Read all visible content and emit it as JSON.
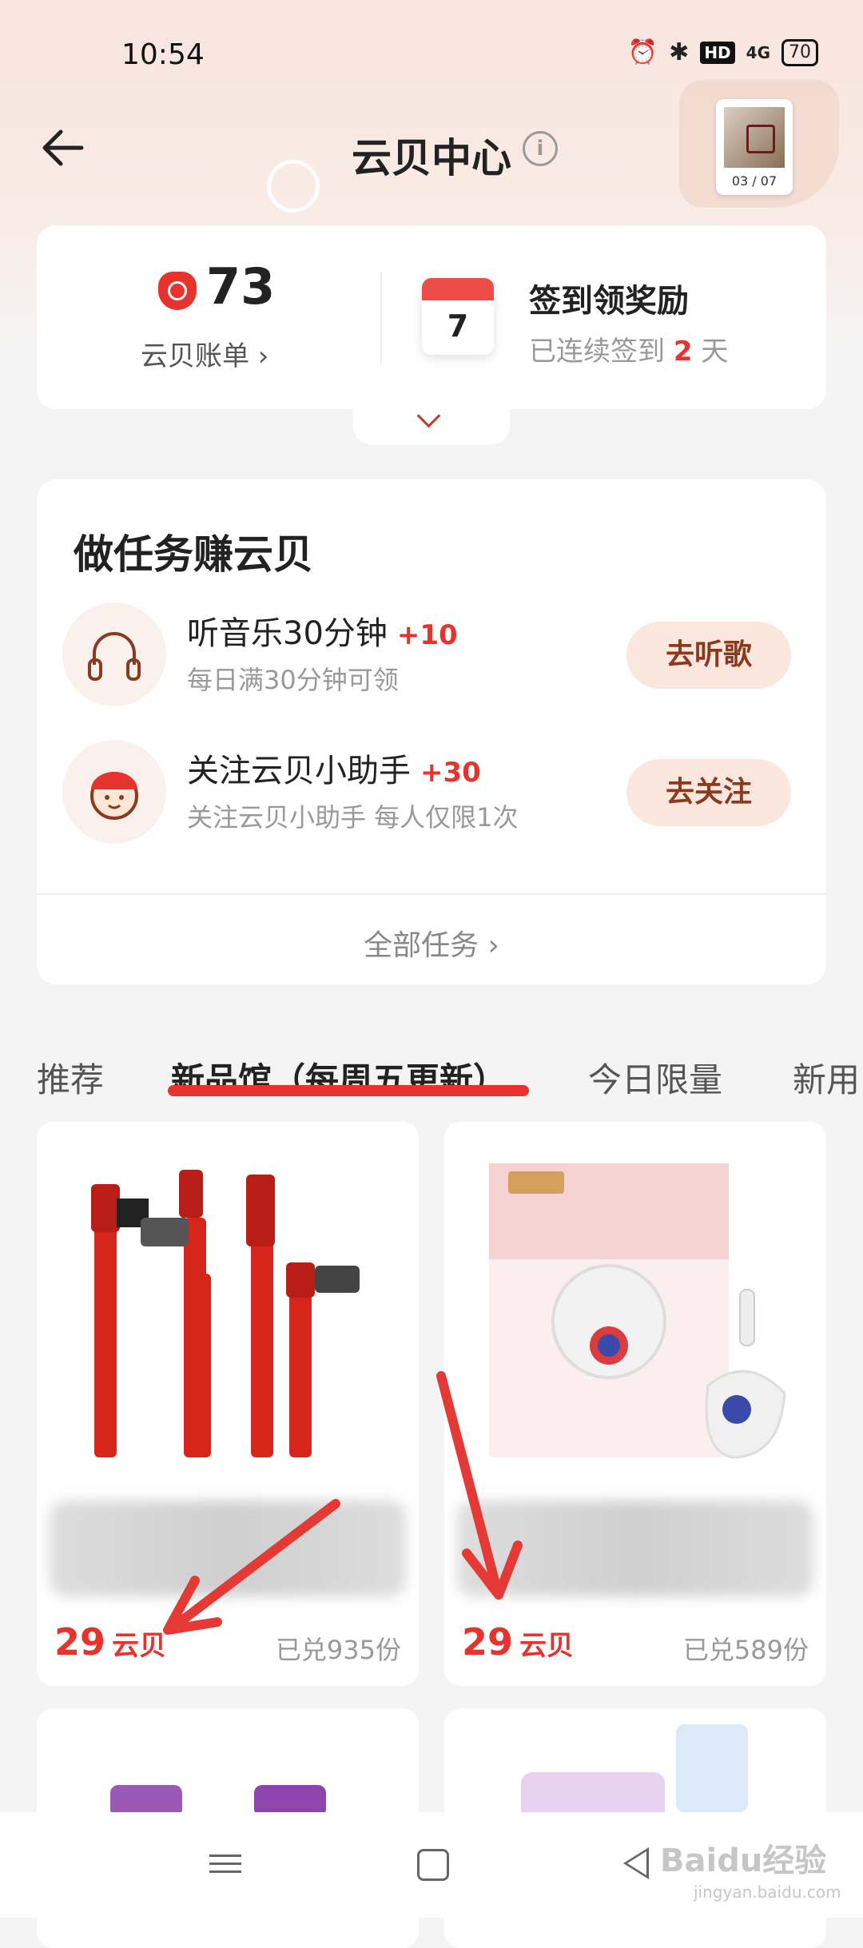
{
  "status_bar": {
    "time": "10:54",
    "hd_badge": "HD",
    "signal_label": "4G",
    "battery": "70"
  },
  "header": {
    "title": "云贝中心",
    "info_glyph": "i",
    "album_count": "03 / 07"
  },
  "summary": {
    "balance": "73",
    "bill_link": "云贝账单 ›",
    "calendar_day": "7",
    "checkin_title": "签到领奖励",
    "checkin_prefix": "已连续签到",
    "checkin_days": "2",
    "checkin_suffix": "天"
  },
  "tasks": {
    "heading": "做任务赚云贝",
    "items": [
      {
        "title": "听音乐30分钟",
        "reward": "+10",
        "desc": "每日满30分钟可领",
        "button": "去听歌",
        "icon": "headphones-icon"
      },
      {
        "title": "关注云贝小助手",
        "reward": "+30",
        "desc": "关注云贝小助手 每人仅限1次",
        "button": "去关注",
        "icon": "assistant-avatar-icon"
      }
    ],
    "all_tasks": "全部任务 ›"
  },
  "tabs": [
    {
      "label": "推荐",
      "active": false
    },
    {
      "label": "新品馆（每周五更新）",
      "active": true
    },
    {
      "label": "今日限量",
      "active": false
    },
    {
      "label": "新用",
      "active": false
    }
  ],
  "products": [
    {
      "price": "29",
      "unit": "云贝",
      "sold": "已兑935份",
      "image": "red-cable-image"
    },
    {
      "price": "29",
      "unit": "云贝",
      "sold": "已兑589份",
      "image": "mickey-earbuds-image"
    }
  ],
  "watermark": {
    "brand": "Baidu经验",
    "url": "jingyan.baidu.com"
  },
  "colors": {
    "accent_red": "#e8322e",
    "button_bg": "#fbe7dd",
    "header_bg": "#f7e5df"
  }
}
